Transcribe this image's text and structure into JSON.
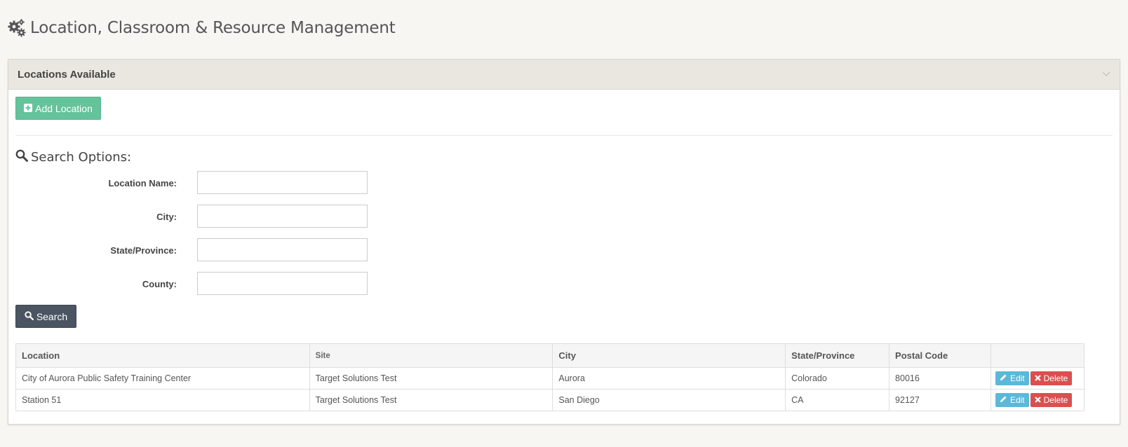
{
  "page": {
    "title": "Location, Classroom & Resource Management",
    "title_icon": "gears-icon"
  },
  "panel": {
    "title": "Locations Available",
    "collapse_icon": "chevron-down-icon"
  },
  "add_button": {
    "label": "Add Location",
    "icon": "plus-square-icon",
    "color": "#64c39b"
  },
  "search": {
    "heading": "Search Options:",
    "icon": "search-icon",
    "fields": [
      {
        "label": "Location Name:",
        "value": "",
        "placeholder": ""
      },
      {
        "label": "City:",
        "value": "",
        "placeholder": ""
      },
      {
        "label": "State/Province:",
        "value": "",
        "placeholder": ""
      },
      {
        "label": "County:",
        "value": "",
        "placeholder": ""
      }
    ],
    "button_label": "Search",
    "button_color": "#4b5461"
  },
  "table": {
    "headers": [
      "Location",
      "Site",
      "City",
      "State/Province",
      "Postal Code",
      ""
    ],
    "rows": [
      {
        "location": "City of Aurora Public Safety Training Center",
        "site": "Target Solutions Test",
        "city": "Aurora",
        "state": "Colorado",
        "postal": "80016"
      },
      {
        "location": "Station 51",
        "site": "Target Solutions Test",
        "city": "San Diego",
        "state": "CA",
        "postal": "92127"
      }
    ],
    "edit_label": "Edit",
    "delete_label": "Delete",
    "edit_color": "#5bb8d9",
    "delete_color": "#db4f4f"
  }
}
